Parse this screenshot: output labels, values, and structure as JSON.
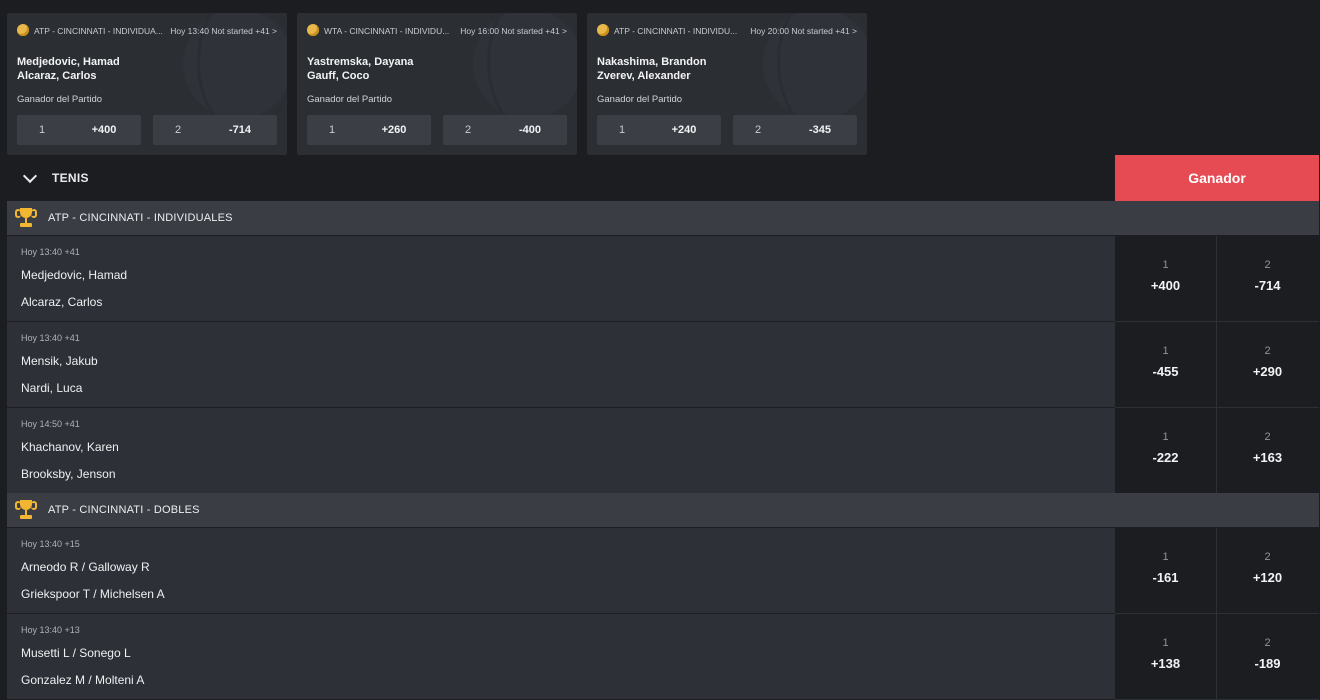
{
  "featured": [
    {
      "league": "ATP - CINCINNATI - INDIVIDUA...",
      "status": "Hoy 13:40 Not started +41 >",
      "player1": "Medjedovic, Hamad",
      "player2": "Alcaraz, Carlos",
      "market": "Ganador del Partido",
      "sel1": "1",
      "odd1": "+400",
      "sel2": "2",
      "odd2": "-714"
    },
    {
      "league": "WTA - CINCINNATI - INDIVIDU...",
      "status": "Hoy 16:00 Not started +41 >",
      "player1": "Yastremska, Dayana",
      "player2": "Gauff, Coco",
      "market": "Ganador del Partido",
      "sel1": "1",
      "odd1": "+260",
      "sel2": "2",
      "odd2": "-400"
    },
    {
      "league": "ATP - CINCINNATI - INDIVIDU...",
      "status": "Hoy 20:00 Not started +41 >",
      "player1": "Nakashima, Brandon",
      "player2": "Zverev, Alexander",
      "market": "Ganador del Partido",
      "sel1": "1",
      "odd1": "+240",
      "sel2": "2",
      "odd2": "-345"
    }
  ],
  "sport": {
    "title": "TENIS",
    "market_header": "Ganador"
  },
  "leagues": [
    {
      "name": "ATP - CINCINNATI - INDIVIDUALES"
    },
    {
      "name": "ATP - CINCINNATI - DOBLES"
    }
  ],
  "events": [
    {
      "time": "Hoy 13:40 +41",
      "team1": "Medjedovic, Hamad",
      "team2": "Alcaraz, Carlos",
      "sel1": "1",
      "odd1": "+400",
      "sel2": "2",
      "odd2": "-714"
    },
    {
      "time": "Hoy 13:40 +41",
      "team1": "Mensik, Jakub",
      "team2": "Nardi, Luca",
      "sel1": "1",
      "odd1": "-455",
      "sel2": "2",
      "odd2": "+290"
    },
    {
      "time": "Hoy 14:50 +41",
      "team1": "Khachanov, Karen",
      "team2": "Brooksby, Jenson",
      "sel1": "1",
      "odd1": "-222",
      "sel2": "2",
      "odd2": "+163"
    },
    {
      "time": "Hoy 13:40 +15",
      "team1": "Arneodo R / Galloway R",
      "team2": "Griekspoor T / Michelsen A",
      "sel1": "1",
      "odd1": "-161",
      "sel2": "2",
      "odd2": "+120"
    },
    {
      "time": "Hoy 13:40 +13",
      "team1": "Musetti L / Sonego L",
      "team2": "Gonzalez M / Molteni A",
      "sel1": "1",
      "odd1": "+138",
      "sel2": "2",
      "odd2": "-189"
    }
  ],
  "colors": {
    "accent": "#e64a52",
    "trophy": "#f2b632",
    "background": "#1b1d20"
  }
}
